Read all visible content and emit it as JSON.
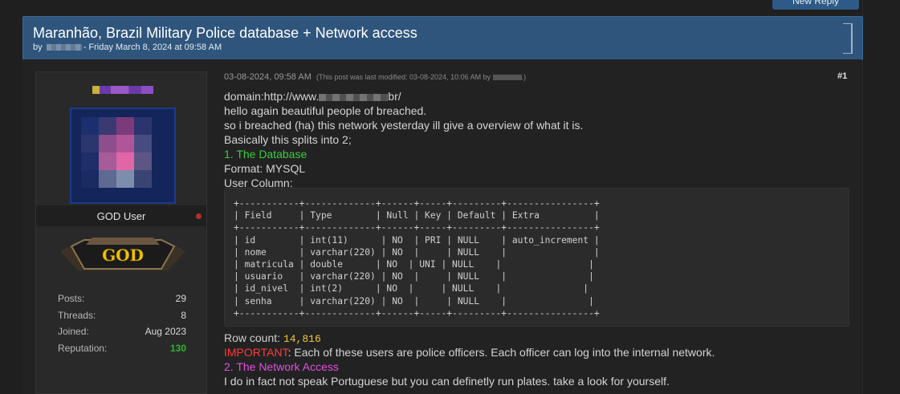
{
  "header": {
    "reply_button_label": "New Reply"
  },
  "thread": {
    "title": "Maranhão, Brazil Military Police database + Network access",
    "by_label": "by",
    "meta_date": "- Friday March 8, 2024 at 09:58 AM"
  },
  "author": {
    "usergroup": "GOD User",
    "badge_text": "GOD",
    "stats": [
      {
        "label": "Posts:",
        "value": "29"
      },
      {
        "label": "Threads:",
        "value": "8"
      },
      {
        "label": "Joined:",
        "value": "Aug 2023"
      },
      {
        "label": "Reputation:",
        "value": "130"
      }
    ],
    "status_color": "#b3302b",
    "reputation_color": "#2db52d"
  },
  "post": {
    "date": "03-08-2024, 09:58 AM",
    "modified_prefix": "(This post was last modified: 03-08-2024, 10:06 AM by",
    "modified_suffix": ".)",
    "number": "#1",
    "domain_prefix": "domain:http://www.",
    "domain_suffix": "br/",
    "lines": [
      "hello again beautiful people of breached.",
      "so i breached (ha) this network yesterday ill give a overview of what it is.",
      "Basically this splits into 2;"
    ],
    "section1_heading": "1. The Database",
    "format_line": "Format: MYSQL",
    "user_column_label": "User Column:",
    "code": "+-----------+-------------+------+-----+---------+----------------+\n| Field     | Type        | Null | Key | Default | Extra          |\n+-----------+-------------+------+-----+---------+----------------+\n| id        | int(11)      | NO  | PRI | NULL    | auto_increment |\n| nome      | varchar(220) | NO  |     | NULL    |                |\n| matricula | double      | NO  | UNI | NULL    |                |\n| usuario   | varchar(220) | NO  |     | NULL    |               |\n| id_nivel  | int(2)      | NO  |     | NULL    |               |\n| senha     | varchar(220) | NO  |     | NULL    |               |\n+-----------+-------------+------+-----+---------+----------------+",
    "row_count_label": "Row count:",
    "row_count_value": "14,816",
    "important_label": "IMPORTANT",
    "important_text": ": Each of these users are police officers. Each officer can log into the internal network.",
    "section2_heading": "2. The Network Access",
    "closing_line": "I do in fact not speak Portuguese but you can definetly run plates. take a look for yourself."
  },
  "colors": {
    "header_bg": "#2f557c",
    "section1_color": "#3ccc3c",
    "section2_color": "#e04fe0",
    "important_color": "#ff3a3a",
    "row_count_color": "#f5c542"
  }
}
